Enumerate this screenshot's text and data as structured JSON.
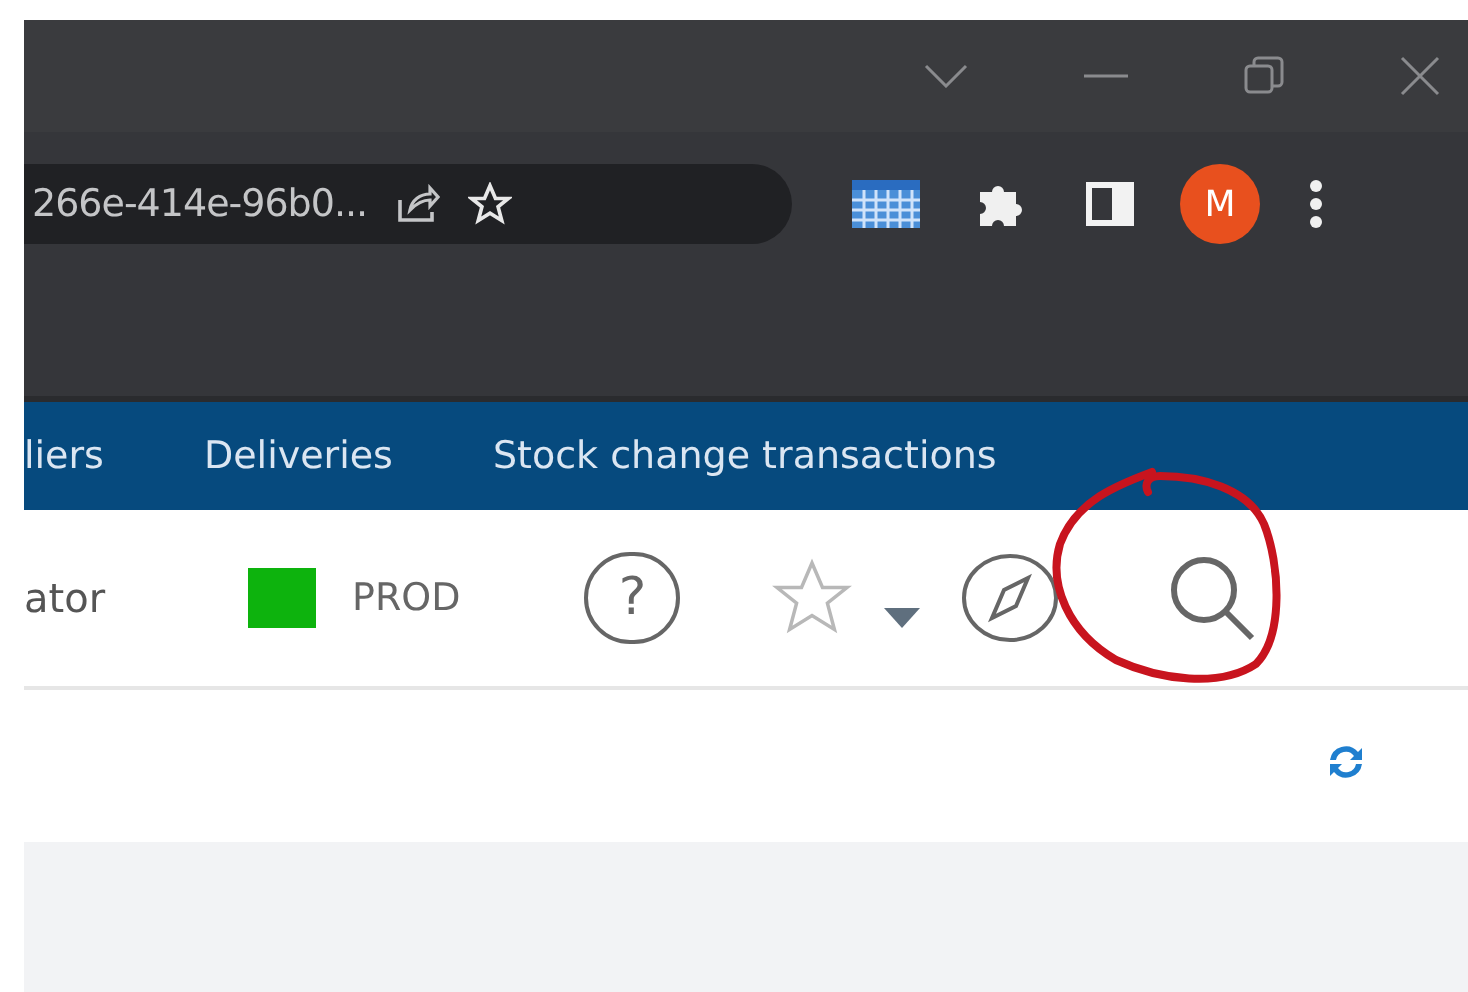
{
  "browser": {
    "address": "266e-414e-96b0...",
    "profile_initial": "M"
  },
  "nav": {
    "items": [
      {
        "label": "liers"
      },
      {
        "label": "Deliveries"
      },
      {
        "label": "Stock change transactions"
      }
    ]
  },
  "toolbar": {
    "user_label": "ator",
    "environment": "PROD",
    "help_glyph": "?"
  }
}
